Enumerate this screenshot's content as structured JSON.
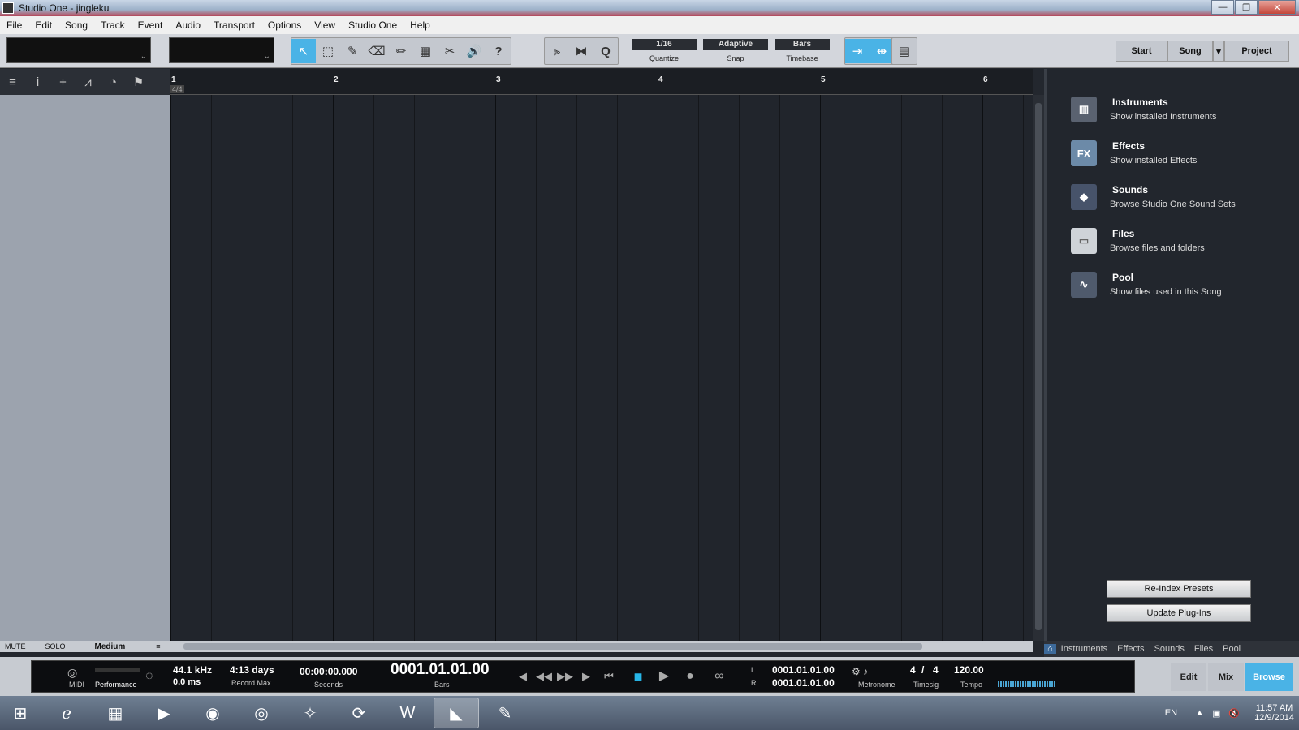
{
  "window": {
    "title": "Studio One - jingleku",
    "minimize": "—",
    "maximize": "❐",
    "close": "✕"
  },
  "menu": [
    "File",
    "Edit",
    "Song",
    "Track",
    "Event",
    "Audio",
    "Transport",
    "Options",
    "View",
    "Studio One",
    "Help"
  ],
  "toolbar": {
    "tools": [
      "arrow-tool",
      "range-tool",
      "split-tool",
      "eraser-tool",
      "paint-tool",
      "mute-tool",
      "bend-tool",
      "listen-tool",
      "help-tool"
    ],
    "tool_glyphs": [
      "↖",
      "⬚",
      "✎",
      "⌫",
      "✏",
      "▦",
      "✂",
      "🔊",
      "?"
    ],
    "quantize": {
      "value": "1/16",
      "label": "Quantize"
    },
    "snap": {
      "value": "Adaptive",
      "label": "Snap"
    },
    "timebase": {
      "value": "Bars",
      "label": "Timebase"
    },
    "help": "?",
    "q_glyph": "Q"
  },
  "page_tabs": [
    "Start",
    "Song",
    "Project"
  ],
  "track_tools": [
    "≡",
    "i",
    "+",
    "⩘",
    "◔",
    "⚑"
  ],
  "left_bottom": {
    "mute": "MUTE",
    "solo": "SOLO",
    "size": "Medium"
  },
  "ruler": {
    "bars": [
      "1",
      "2",
      "3",
      "4",
      "5",
      "6"
    ],
    "timesig": "4/4"
  },
  "browser": {
    "items": [
      {
        "title": "Instruments",
        "desc": "Show installed Instruments",
        "icon": "piano-icon"
      },
      {
        "title": "Effects",
        "desc": "Show installed Effects",
        "icon": "fx-icon",
        "glyph": "FX"
      },
      {
        "title": "Sounds",
        "desc": "Browse Studio One Sound Sets",
        "icon": "cube-icon"
      },
      {
        "title": "Files",
        "desc": "Browse files and folders",
        "icon": "folder-icon"
      },
      {
        "title": "Pool",
        "desc": "Show files used in this Song",
        "icon": "waveform-icon"
      }
    ],
    "reindex": "Re-Index Presets",
    "update": "Update Plug-Ins",
    "tabs": [
      "Instruments",
      "Effects",
      "Sounds",
      "Files",
      "Pool"
    ]
  },
  "transport": {
    "midi": "MIDI",
    "performance": "Performance",
    "sample_rate": "44.1 kHz",
    "latency": "0.0 ms",
    "record_max": "4:13 days",
    "record_max_label": "Record Max",
    "seconds": "00:00:00.000",
    "seconds_label": "Seconds",
    "bars": "0001.01.01.00",
    "bars_label": "Bars",
    "loop_l": "0001.01.01.00",
    "loop_r": "0001.01.01.00",
    "l_label": "L",
    "r_label": "R",
    "metronome": "Metronome",
    "timesig_num": "4",
    "timesig_den": "4",
    "timesig_label": "Timesig",
    "tempo": "120.00",
    "tempo_label": "Tempo",
    "modes": [
      "Edit",
      "Mix",
      "Browse"
    ]
  },
  "taskbar": {
    "lang": "EN",
    "time": "11:57 AM",
    "date": "12/9/2014"
  }
}
